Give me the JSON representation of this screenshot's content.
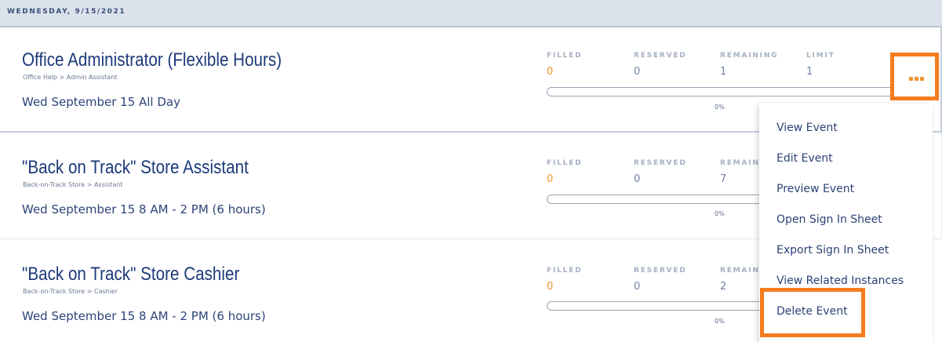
{
  "date_header": "WEDNESDAY, 9/15/2021",
  "stat_labels": {
    "filled": "FILLED",
    "reserved": "RESERVED",
    "remaining": "REMAINING",
    "remaining_truncated": "REMAIN",
    "limit": "LIMIT"
  },
  "events": [
    {
      "title": "Office Administrator (Flexible Hours)",
      "category": "Office Help > Admin Assistant",
      "time": "Wed September 15 All Day",
      "filled": "0",
      "reserved": "0",
      "remaining": "1",
      "limit": "1",
      "progress_label": "0%",
      "progress_fraction": 0
    },
    {
      "title": "\"Back on Track\" Store Assistant",
      "category": "Back-on-Track Store > Assistant",
      "time": "Wed September 15 8 AM - 2 PM (6 hours)",
      "filled": "0",
      "reserved": "0",
      "remaining": "7",
      "progress_label": "0%",
      "progress_fraction": 0
    },
    {
      "title": "\"Back on Track\" Store Cashier",
      "category": "Back-on-Track Store > Cashier",
      "time": "Wed September 15 8 AM - 2 PM (6 hours)",
      "filled": "0",
      "reserved": "0",
      "remaining": "2",
      "progress_label": "0%",
      "progress_fraction": 0
    }
  ],
  "menu": {
    "items": [
      "View Event",
      "Edit Event",
      "Preview Event",
      "Open Sign In Sheet",
      "Export Sign In Sheet",
      "View Related Instances",
      "Delete Event"
    ]
  },
  "icons": {
    "more": "more-horizontal-icon"
  },
  "colors": {
    "accent": "#f0932b",
    "highlight": "#f57c1f",
    "title": "#1d3a7a",
    "header_bg": "#dbe2ec"
  }
}
